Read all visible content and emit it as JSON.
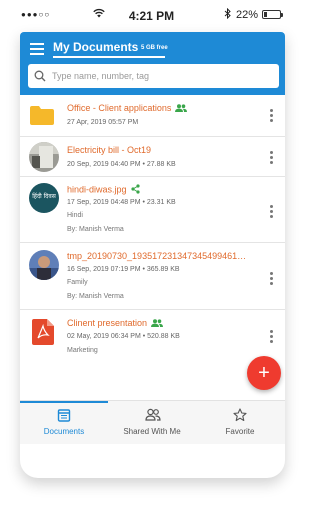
{
  "status_bar": {
    "signal": "●●●○○",
    "time": "4:21 PM",
    "battery_percent": "22%",
    "battery_level": 0.22
  },
  "header": {
    "title": "My Documents",
    "storage": "5 GB free",
    "search_placeholder": "Type name, number, tag",
    "color": "#1e8ad6"
  },
  "files": [
    {
      "name": "Office - Client applications",
      "meta": "27 Apr, 2019 05:57 PM",
      "tag": "",
      "by": "",
      "icon": "folder-icon",
      "shared_icon": "shared-people-icon"
    },
    {
      "name": "Electricity bill - Oct19",
      "meta": "20 Sep, 2019 04:40 PM  •  27.88 KB",
      "tag": "",
      "by": "",
      "icon": "image-thumbnail"
    },
    {
      "name": "hindi-diwas.jpg",
      "meta": "17 Sep, 2019 04:48 PM  •  23.31 KB",
      "tag": "Hindi",
      "by": "By: Manish Verma",
      "icon": "image-thumbnail",
      "thumb_text": "हिंदी दिवस",
      "shared_icon": "share-icon"
    },
    {
      "name": "tmp_20190730_193517231347345499461…",
      "meta": "16 Sep, 2019 07:19 PM  •  365.89 KB",
      "tag": "Family",
      "by": "By: Manish Verma",
      "icon": "image-thumbnail"
    },
    {
      "name": "Clinent presentation",
      "meta": "02 May, 2019 06:34 PM  •  520.88 KB",
      "tag": "Marketing",
      "by": "",
      "icon": "pdf-icon",
      "shared_icon": "shared-people-icon"
    }
  ],
  "fab": {
    "label": "+",
    "color": "#ef3b2f"
  },
  "bottom_nav": [
    {
      "label": "Documents",
      "icon": "documents-icon",
      "active": true
    },
    {
      "label": "Shared With Me",
      "icon": "people-icon",
      "active": false
    },
    {
      "label": "Favorite",
      "icon": "star-icon",
      "active": false
    }
  ],
  "colors": {
    "accent": "#1e8ad6",
    "file_name": "#e06a2c",
    "folder": "#f5b82a",
    "shared": "#3aa64a",
    "pdf": "#e4492c"
  }
}
